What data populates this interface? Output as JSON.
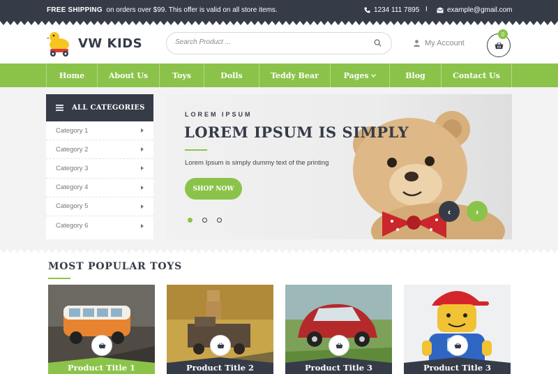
{
  "topbar": {
    "shipping_bold": "FREE SHIPPING",
    "shipping_text": "on orders over $99. This offer is valid on all store items.",
    "phone": "1234 111 7895",
    "separator": "I",
    "email": "example@gmail.com"
  },
  "header": {
    "logo_text": "VW KIDS",
    "search_placeholder": "Search Product ...",
    "account_label": "My Account",
    "cart_count": "0"
  },
  "nav": {
    "items": [
      {
        "label": "Home"
      },
      {
        "label": "About Us"
      },
      {
        "label": "Toys"
      },
      {
        "label": "Dolls"
      },
      {
        "label": "Teddy Bear"
      },
      {
        "label": "Pages"
      },
      {
        "label": "Blog"
      },
      {
        "label": "Contact Us"
      }
    ]
  },
  "categories": {
    "heading": "ALL CATEGORIES",
    "items": [
      {
        "label": "Category 1"
      },
      {
        "label": "Category 2"
      },
      {
        "label": "Category 3"
      },
      {
        "label": "Category 4"
      },
      {
        "label": "Category 5"
      },
      {
        "label": "Category 6"
      }
    ]
  },
  "slider": {
    "kicker": "LOREM IPSUM",
    "headline": "LOREM IPSUM IS SIMPLY",
    "description": "Lorem Ipsum is simply dummy text of the printing",
    "button_label": "SHOP NOW",
    "prev_label": "‹",
    "next_label": "›",
    "active_slide": 1,
    "slide_count": 3
  },
  "popular": {
    "title": "MOST POPULAR TOYS",
    "products": [
      {
        "title": "Product Title 1",
        "bar_color": "#8bc34a"
      },
      {
        "title": "Product Title 2",
        "bar_color": "#363b48"
      },
      {
        "title": "Product Title 3",
        "bar_color": "#363b48"
      },
      {
        "title": "Product Title 3",
        "bar_color": "#363b48"
      }
    ]
  },
  "colors": {
    "accent": "#8bc34a",
    "dark": "#363b48"
  }
}
